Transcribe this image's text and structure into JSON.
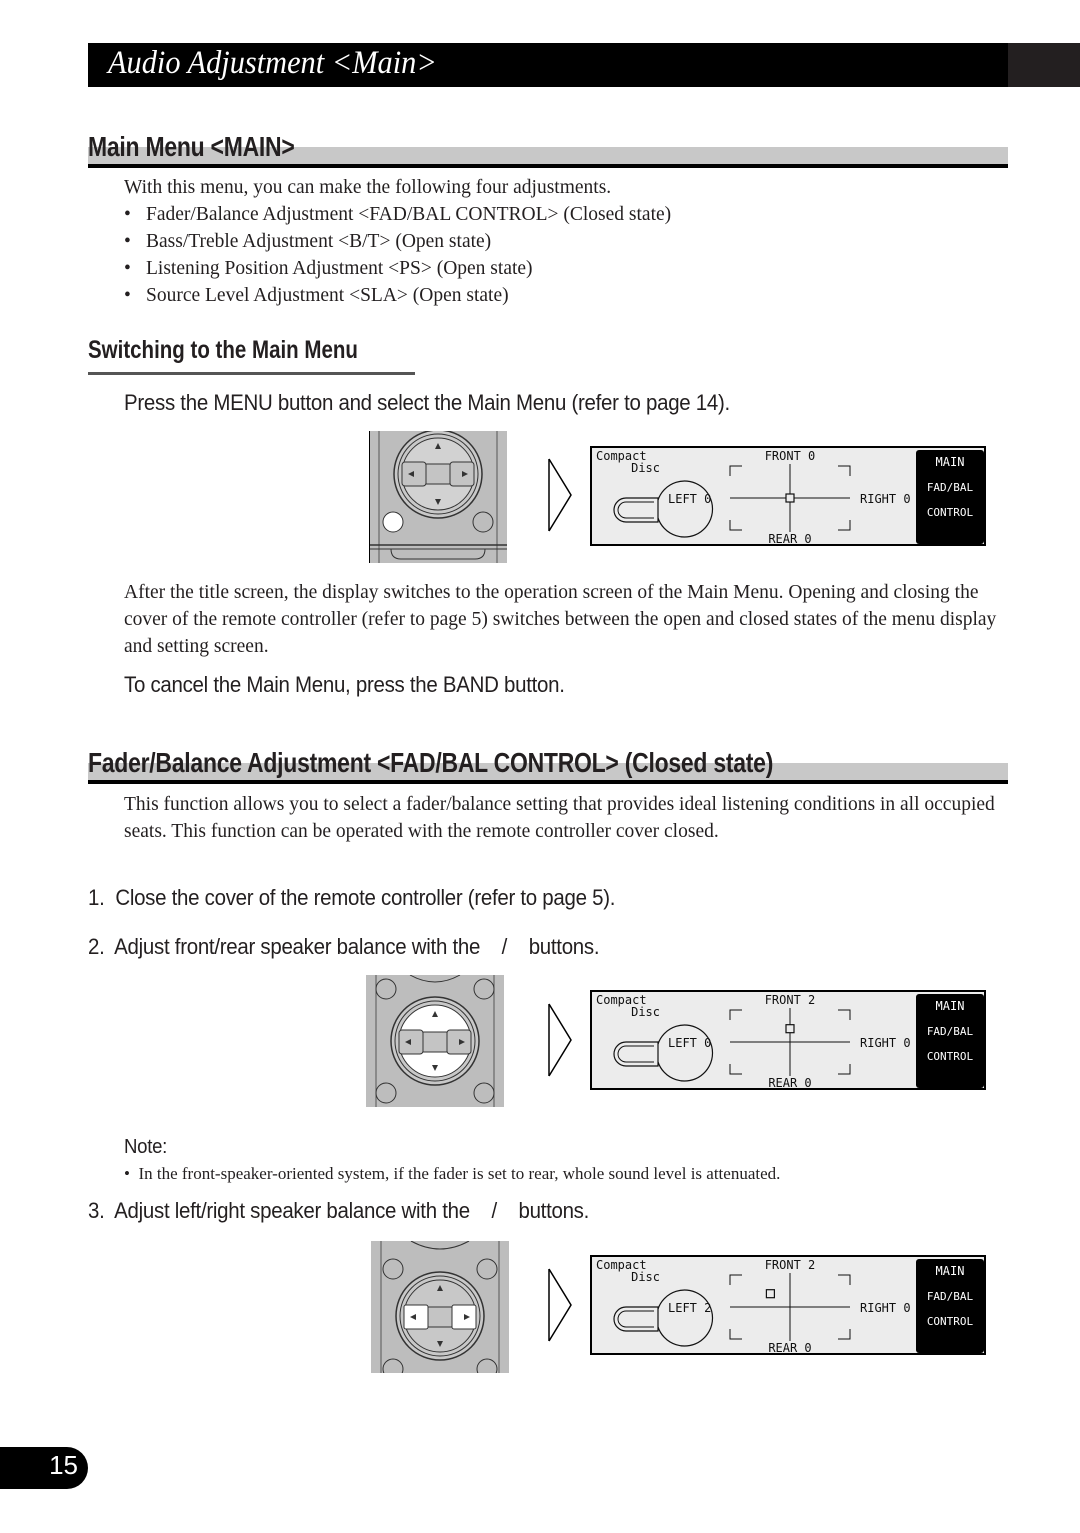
{
  "header": {
    "title": "Audio Adjustment <Main>"
  },
  "section_main": {
    "heading": "Main Menu <MAIN>",
    "intro": "With this menu, you can make the following four adjustments.",
    "items": [
      "Fader/Balance Adjustment <FAD/BAL CONTROL> (Closed state)",
      "Bass/Treble Adjustment <B/T> (Open state)",
      "Listening Position Adjustment <PS> (Open state)",
      "Source Level Adjustment <SLA> (Open state)"
    ]
  },
  "section_switch": {
    "heading": "Switching to the Main Menu",
    "instruction": "Press the MENU button and select the Main Menu (refer to page 14).",
    "paragraph": "After the title screen, the display switches to the operation screen of the Main Menu. Opening and closing the cover of the remote controller (refer to page 5) switches between the open and closed states of the menu display and setting screen.",
    "cancel": "To cancel the Main Menu, press the BAND button."
  },
  "section_fadbal": {
    "heading": "Fader/Balance Adjustment <FAD/BAL CONTROL> (Closed state)",
    "paragraph": "This function allows you to select a fader/balance setting that provides ideal listening conditions in all occupied seats. This function can be operated with the remote controller cover closed.",
    "steps": [
      "1.  Close the cover of the remote controller (refer to page 5).",
      "2.  Adjust front/rear speaker balance with the    /    buttons.",
      "3.  Adjust left/right speaker balance with the    /    buttons."
    ],
    "note_label": "Note:",
    "note": "In the front-speaker-oriented system, if the fader is set to rear, whole sound level is attenuated."
  },
  "displays": [
    {
      "source_line1": "Compact",
      "source_line2": "Disc",
      "front": "FRONT 0",
      "rear": "REAR 0",
      "left": "LEFT 0",
      "right": "RIGHT 0",
      "menu": [
        "MAIN",
        "FAD/BAL",
        "CONTROL"
      ],
      "fader": 0,
      "balance": 0
    },
    {
      "source_line1": "Compact",
      "source_line2": "Disc",
      "front": "FRONT 2",
      "rear": "REAR 0",
      "left": "LEFT 0",
      "right": "RIGHT 0",
      "menu": [
        "MAIN",
        "FAD/BAL",
        "CONTROL"
      ],
      "fader": 2,
      "balance": 0
    },
    {
      "source_line1": "Compact",
      "source_line2": "Disc",
      "front": "FRONT 2",
      "rear": "REAR 0",
      "left": "LEFT 2",
      "right": "RIGHT 0",
      "menu": [
        "MAIN",
        "FAD/BAL",
        "CONTROL"
      ],
      "fader": 2,
      "balance": -2
    }
  ],
  "icons": {
    "remote": "remote-controller-joystick-icon",
    "arrow": "right-arrow-outline-icon",
    "disc": "compact-disc-icon"
  },
  "page_number": "15"
}
